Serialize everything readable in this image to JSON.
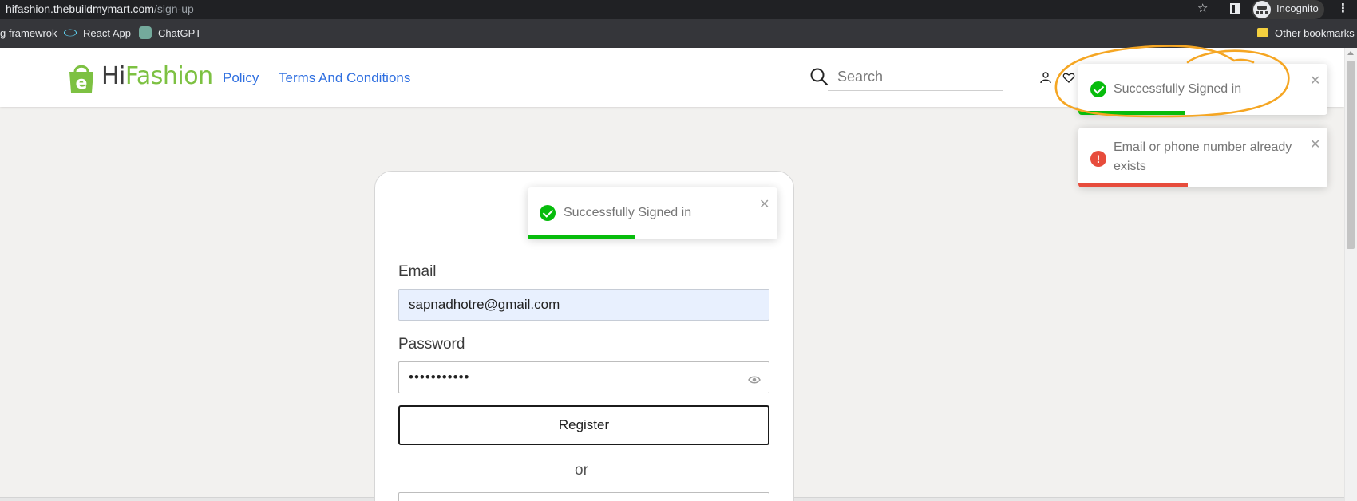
{
  "browser": {
    "url_host": "hifashion.thebuildmymart.com",
    "url_path": "/sign-up",
    "profile_label": "Incognito",
    "bookmarks": [
      "g framewrok",
      "React App",
      "ChatGPT"
    ],
    "other_bookmarks": "Other bookmarks"
  },
  "header": {
    "logo_hi": "Hi",
    "logo_fashion": "Fashion",
    "nav": [
      "Policy",
      "Terms And Conditions"
    ],
    "search_placeholder": "Search"
  },
  "form": {
    "email_label": "Email",
    "email_value": "sapnadhotre@gmail.com",
    "password_label": "Password",
    "password_value": "•••••••••••",
    "register_label": "Register",
    "or_label": "or"
  },
  "toasts": [
    {
      "type": "success",
      "message": "Successfully Signed in",
      "close": "✕",
      "progress": 0.43
    },
    {
      "type": "success",
      "message": "Successfully Signed in",
      "close": "✕",
      "progress": 0.43
    },
    {
      "type": "error",
      "message": "Email or phone number already exists",
      "close": "✕",
      "progress": 0.44
    }
  ],
  "colors": {
    "brand_green": "#7dc142",
    "link_blue": "#2f6fe0",
    "success": "#07bc0c",
    "error": "#e74c3c",
    "annotation": "#f5a623"
  }
}
